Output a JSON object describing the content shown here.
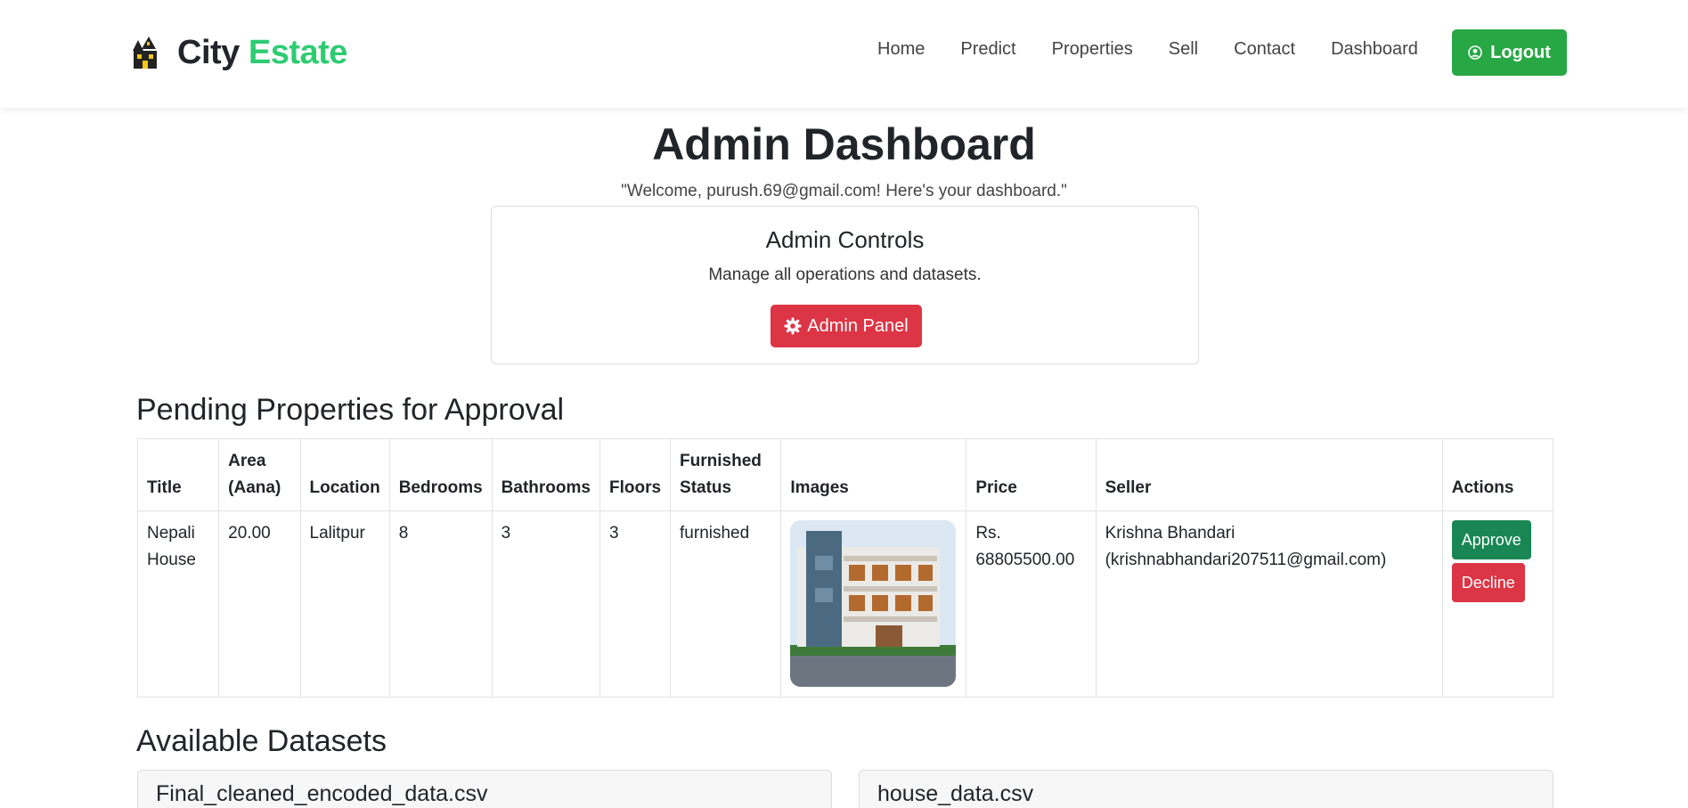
{
  "brand": {
    "name": "City",
    "accent": "Estate",
    "icon": "haunted-house-icon"
  },
  "nav": {
    "links": [
      "Home",
      "Predict",
      "Properties",
      "Sell",
      "Contact",
      "Dashboard"
    ],
    "logout_label": "Logout",
    "logout_icon": "user-circle-icon"
  },
  "header": {
    "title": "Admin Dashboard",
    "welcome": "\"Welcome, purush.69@gmail.com! Here's your dashboard.\""
  },
  "admin_controls": {
    "title": "Admin Controls",
    "description": "Manage all operations and datasets.",
    "button_label": "Admin Panel",
    "button_icon": "gear-icon"
  },
  "pending": {
    "title": "Pending Properties for Approval",
    "columns": [
      "Title",
      "Area (Aana)",
      "Location",
      "Bedrooms",
      "Bathrooms",
      "Floors",
      "Furnished Status",
      "Images",
      "Price",
      "Seller",
      "Actions"
    ],
    "rows": [
      {
        "title": "Nepali House",
        "area": "20.00",
        "location": "Lalitpur",
        "bedrooms": "8",
        "bathrooms": "3",
        "floors": "3",
        "furnished": "furnished",
        "image": "house-photo",
        "price": "Rs. 68805500.00",
        "seller": "Krishna Bhandari (krishnabhandari207511@gmail.com)",
        "approve_label": "Approve",
        "decline_label": "Decline"
      }
    ]
  },
  "datasets": {
    "title": "Available Datasets",
    "files": [
      "Final_cleaned_encoded_data.csv",
      "house_data.csv"
    ]
  },
  "colors": {
    "accent": "#2ecc71",
    "success": "#28a745",
    "danger": "#dc3545"
  }
}
